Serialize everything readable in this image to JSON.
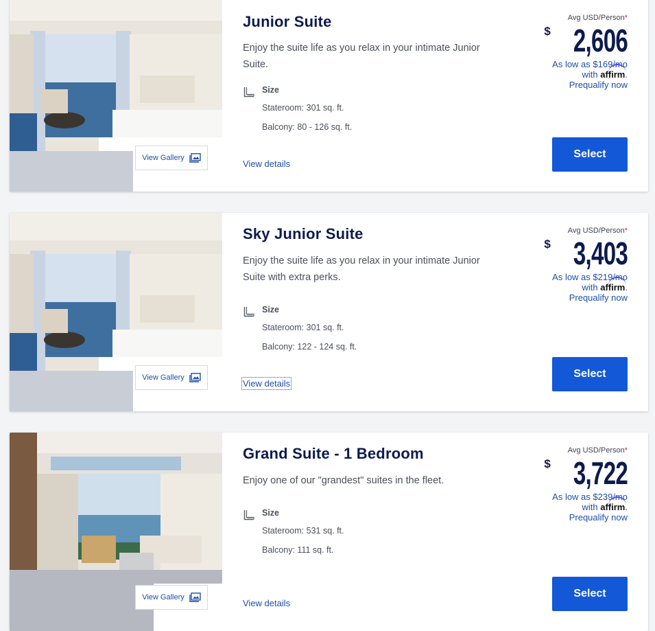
{
  "gallery_label": "View Gallery",
  "size_label": "Size",
  "view_details_label": "View details",
  "avg_label": "Avg USD/Person",
  "asterisk": "*",
  "currency_symbol": "$",
  "with_label": "with",
  "affirm_label": "affirm",
  "period": ".",
  "prequalify_label": "Prequalify now",
  "select_label": "Select",
  "colors": {
    "accent": "#1358d6",
    "link": "#1d4fa6",
    "title": "#0d1b4d"
  },
  "suites": [
    {
      "title": "Junior Suite",
      "description": "Enjoy the suite life as you relax in your intimate Junior Suite.",
      "stateroom": "Stateroom: 301 sq. ft.",
      "balcony": "Balcony: 80 - 126 sq. ft.",
      "price": "2,606",
      "monthly": "As low as $169/mo"
    },
    {
      "title": "Sky Junior Suite",
      "description": "Enjoy the suite life as you relax in your intimate Junior Suite with extra perks.",
      "stateroom": "Stateroom: 301 sq. ft.",
      "balcony": "Balcony: 122 - 124 sq. ft.",
      "price": "3,403",
      "monthly": "As low as $219/mo"
    },
    {
      "title": "Grand Suite - 1 Bedroom",
      "description": "Enjoy one of our \"grandest\" suites in the fleet.",
      "stateroom": "Stateroom: 531 sq. ft.",
      "balcony": "Balcony: 111 sq. ft.",
      "price": "3,722",
      "monthly": "As low as $239/mo"
    }
  ]
}
